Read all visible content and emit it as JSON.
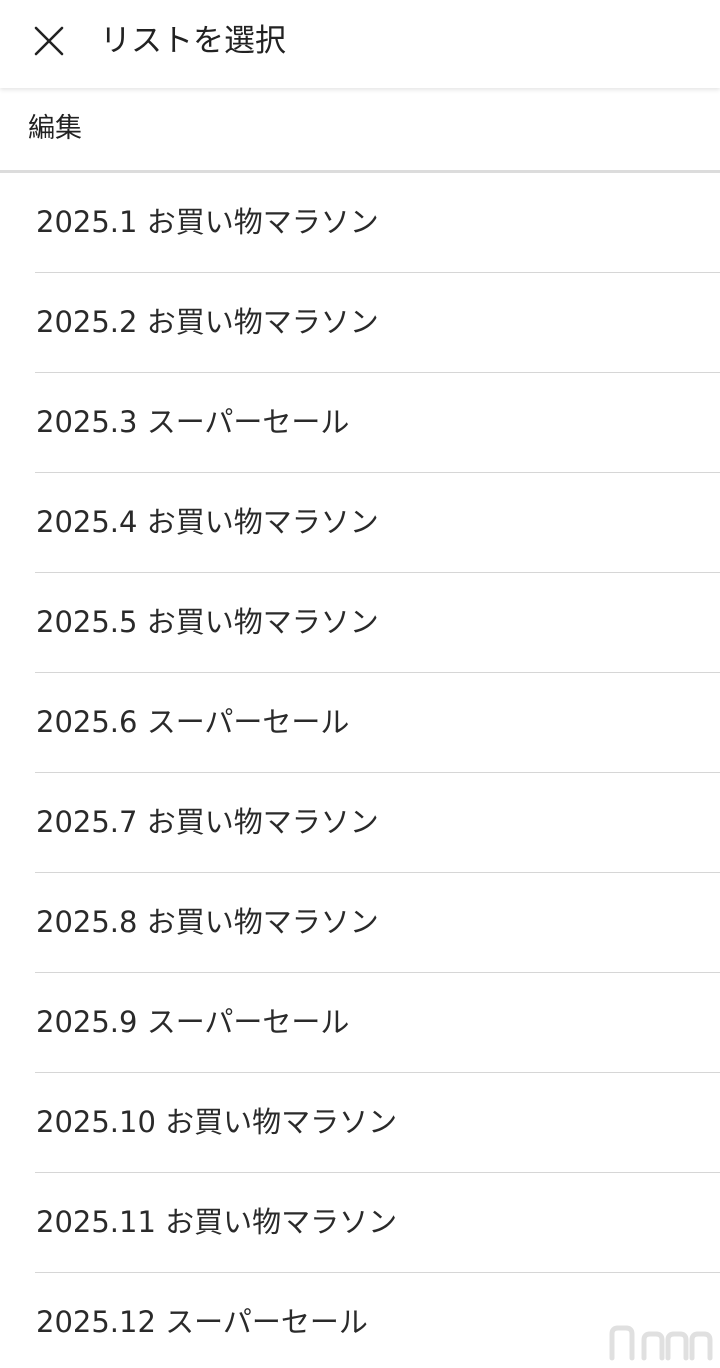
{
  "header": {
    "close_icon": "close-icon",
    "title": "リストを選択"
  },
  "toolbar": {
    "edit_label": "編集"
  },
  "lists": [
    {
      "label": "2025.1 お買い物マラソン"
    },
    {
      "label": "2025.2 お買い物マラソン"
    },
    {
      "label": "2025.3 スーパーセール"
    },
    {
      "label": "2025.4 お買い物マラソン"
    },
    {
      "label": "2025.5 お買い物マラソン"
    },
    {
      "label": "2025.6 スーパーセール"
    },
    {
      "label": "2025.7 お買い物マラソン"
    },
    {
      "label": "2025.8 お買い物マラソン"
    },
    {
      "label": "2025.9 スーパーセール"
    },
    {
      "label": "2025.10 お買い物マラソン"
    },
    {
      "label": "2025.11 お買い物マラソン"
    },
    {
      "label": "2025.12 スーパーセール"
    }
  ],
  "colors": {
    "background": "#ffffff",
    "text": "#222222",
    "divider": "#d6d6d6"
  }
}
